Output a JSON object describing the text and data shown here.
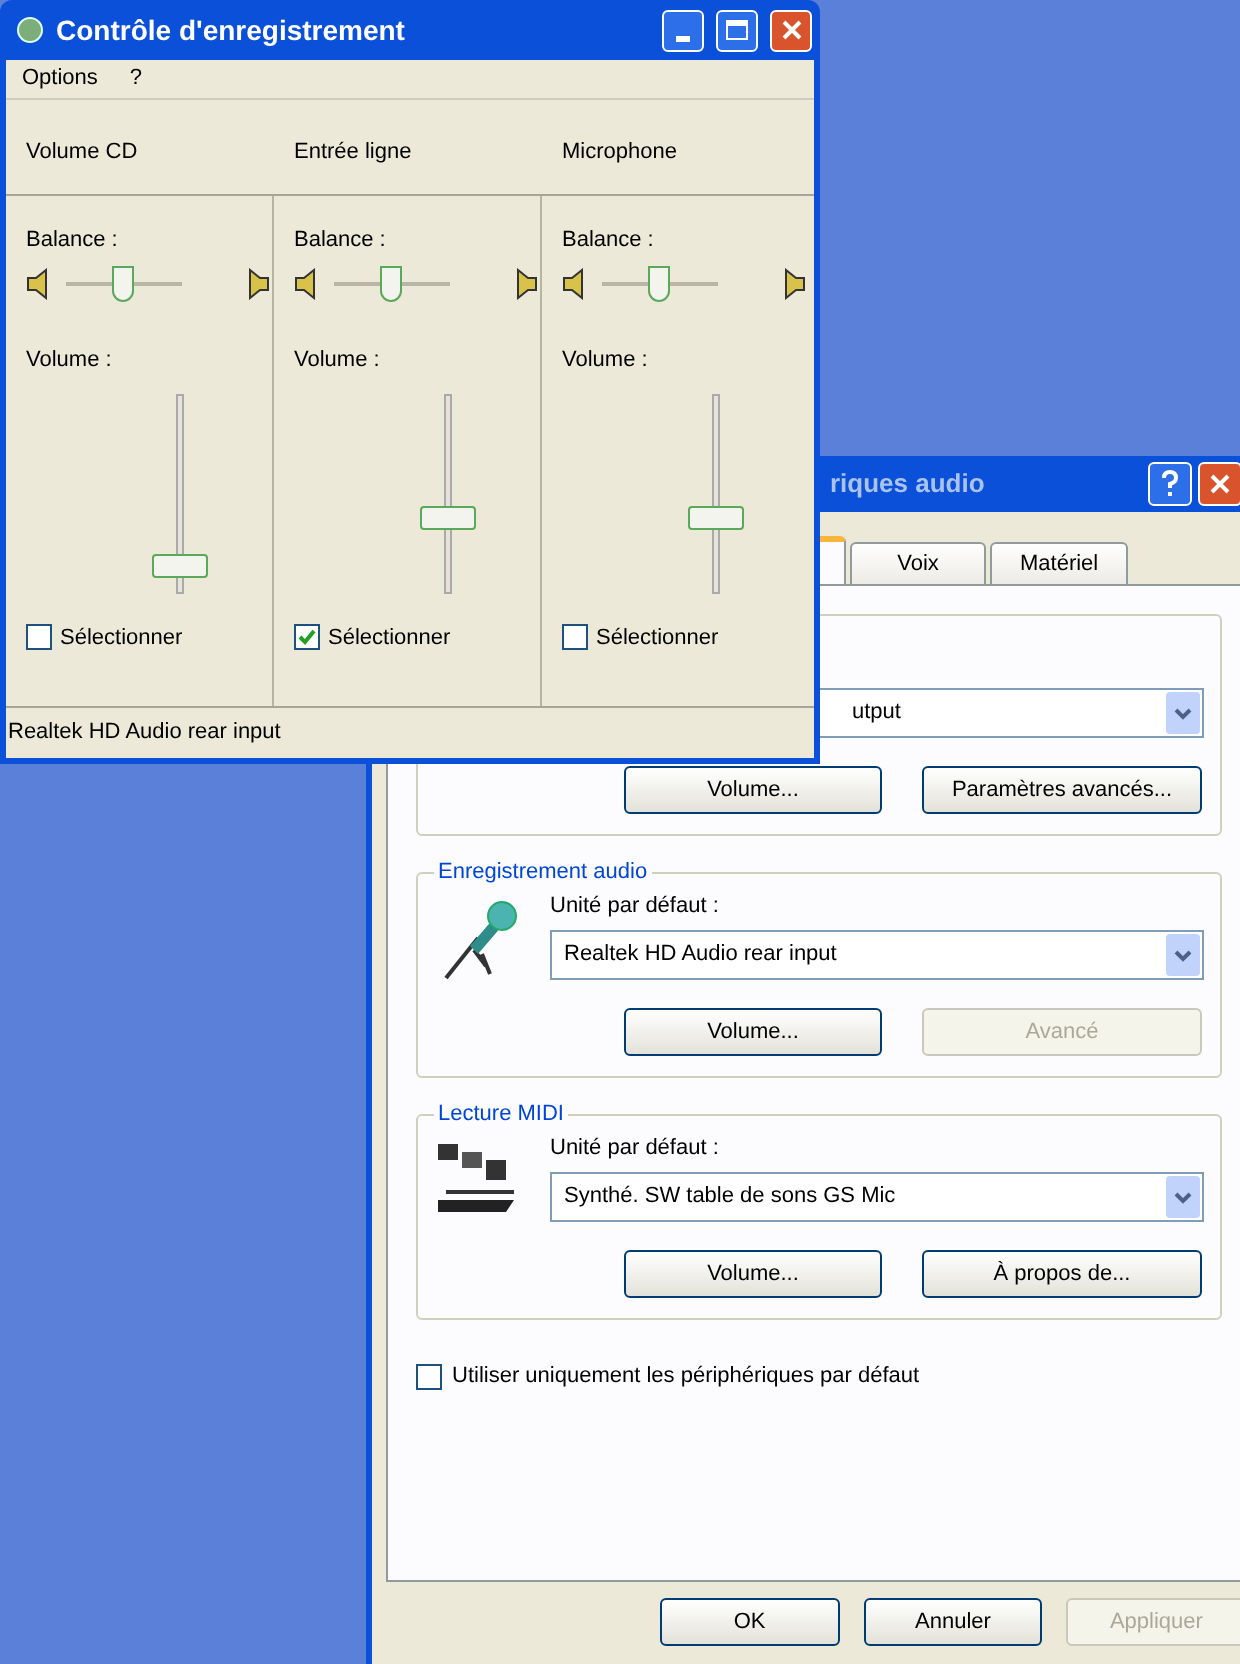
{
  "recording_window": {
    "title": "Contrôle d'enregistrement",
    "menu": [
      "Options",
      "?"
    ],
    "channels": [
      {
        "name": "Volume CD",
        "balance_label": "Balance :",
        "volume_label": "Volume :",
        "volume": {
          "level": 0.08
        },
        "select": {
          "label": "Sélectionner",
          "checked": false
        }
      },
      {
        "name": "Entrée ligne",
        "balance_label": "Balance :",
        "volume_label": "Volume :",
        "volume": {
          "level": 0.35
        },
        "select": {
          "label": "Sélectionner",
          "checked": true
        }
      },
      {
        "name": "Microphone",
        "balance_label": "Balance :",
        "volume_label": "Volume :",
        "volume": {
          "level": 0.35
        },
        "select": {
          "label": "Sélectionner",
          "checked": false
        }
      }
    ],
    "status_bar": "Realtek HD Audio rear input"
  },
  "properties_window": {
    "title": "riques audio",
    "tabs": [
      {
        "selected": true
      },
      {
        "label": "Voix",
        "selected": false
      },
      {
        "label": "Matériel",
        "selected": false
      }
    ],
    "groups": [
      {
        "kind": "output",
        "device": "utput",
        "buttons": [
          {
            "label": "Volume...",
            "disabled": false
          },
          {
            "label": "Paramètres avancés...",
            "disabled": false
          }
        ]
      },
      {
        "title": "Enregistrement audio",
        "kind": "microphone",
        "device_label": "Unité par défaut :",
        "device": "Realtek HD Audio rear input",
        "buttons": [
          {
            "label": "Volume...",
            "disabled": false
          },
          {
            "label": "Avancé",
            "disabled": true
          }
        ]
      },
      {
        "title": "Lecture MIDI",
        "kind": "midi",
        "device_label": "Unité par défaut :",
        "device": "Synthé. SW table de sons GS Mic",
        "buttons": [
          {
            "label": "Volume...",
            "disabled": false
          },
          {
            "label": "À propos de...",
            "disabled": false
          }
        ]
      }
    ],
    "default_only": {
      "label": "Utiliser uniquement les périphériques par défaut",
      "checked": false
    },
    "buttons": [
      {
        "label": "OK",
        "disabled": false
      },
      {
        "label": "Annuler",
        "disabled": false
      },
      {
        "label": "Appliquer",
        "disabled": true
      }
    ]
  }
}
